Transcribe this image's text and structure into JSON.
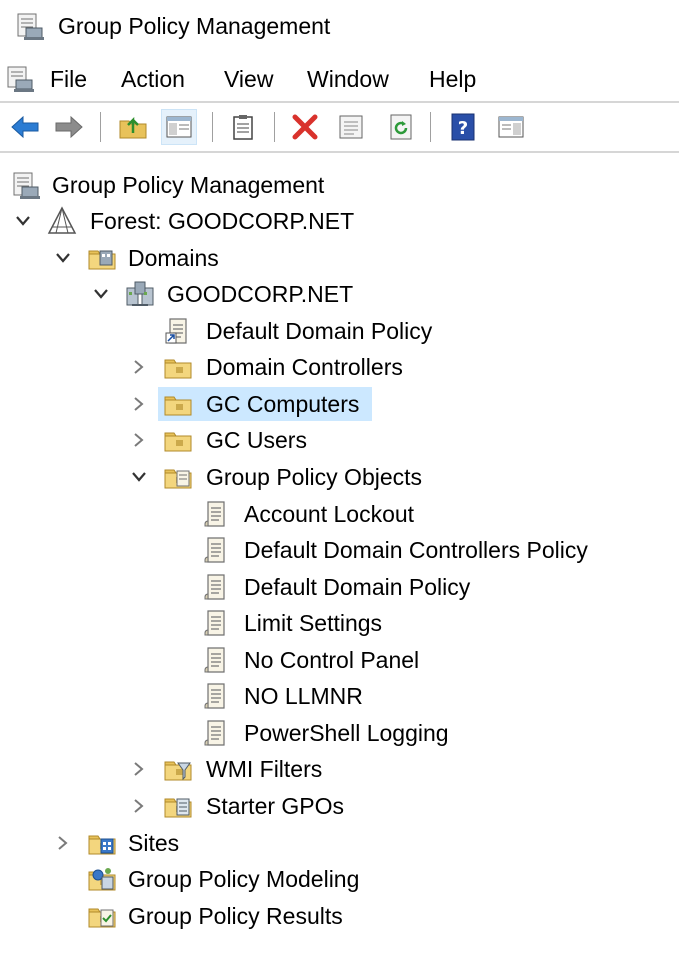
{
  "window": {
    "title": "Group Policy Management"
  },
  "menu": {
    "items": [
      "File",
      "Action",
      "View",
      "Window",
      "Help"
    ]
  },
  "toolbar": {
    "buttons": [
      "back-icon",
      "forward-icon",
      "up-folder-icon",
      "show-hide-tree-icon",
      "properties-icon",
      "delete-icon",
      "export-list-icon",
      "refresh-icon",
      "help-icon",
      "action-pane-icon"
    ],
    "pressed": "show-hide-tree-icon"
  },
  "tree": {
    "root": "Group Policy Management",
    "forest": "Forest: GOODCORP.NET",
    "domains": "Domains",
    "domain": "GOODCORP.NET",
    "default_domain_policy_link": "Default Domain Policy",
    "domain_controllers": "Domain Controllers",
    "gc_computers": "GC Computers",
    "gc_users": "GC Users",
    "gpo_container": "Group Policy Objects",
    "gpos": [
      "Account Lockout",
      "Default Domain Controllers Policy",
      "Default Domain Policy",
      "Limit Settings",
      "No Control Panel",
      "NO LLMNR",
      "PowerShell Logging"
    ],
    "wmi_filters": "WMI Filters",
    "starter_gpos": "Starter GPOs",
    "sites": "Sites",
    "modeling": "Group Policy Modeling",
    "results": "Group Policy Results",
    "selected": "GC Computers"
  },
  "colors": {
    "selection": "#cce8ff",
    "folder": "#e8c25a",
    "arrow_blue": "#2b7cd3"
  }
}
